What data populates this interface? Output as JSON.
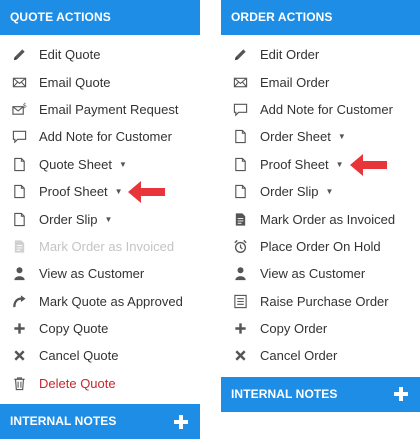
{
  "quote_panel": {
    "title": "QUOTE ACTIONS",
    "items": [
      {
        "label": "Edit Quote"
      },
      {
        "label": "Email Quote"
      },
      {
        "label": "Email Payment Request"
      },
      {
        "label": "Add Note for Customer"
      },
      {
        "label": "Quote Sheet",
        "caret": "▼"
      },
      {
        "label": "Proof Sheet",
        "caret": "▼"
      },
      {
        "label": "Order Slip",
        "caret": "▼"
      },
      {
        "label": "Mark Order as Invoiced"
      },
      {
        "label": "View as Customer"
      },
      {
        "label": "Mark Quote as Approved"
      },
      {
        "label": "Copy Quote"
      },
      {
        "label": "Cancel Quote"
      },
      {
        "label": "Delete Quote"
      }
    ],
    "internal_notes": "INTERNAL NOTES"
  },
  "order_panel": {
    "title": "ORDER ACTIONS",
    "items": [
      {
        "label": "Edit Order"
      },
      {
        "label": "Email Order"
      },
      {
        "label": "Add Note for Customer"
      },
      {
        "label": "Order Sheet",
        "caret": "▼"
      },
      {
        "label": "Proof Sheet",
        "caret": "▼"
      },
      {
        "label": "Order Slip",
        "caret": "▼"
      },
      {
        "label": "Mark Order as Invoiced"
      },
      {
        "label": "Place Order On Hold"
      },
      {
        "label": "View as Customer"
      },
      {
        "label": "Raise Purchase Order"
      },
      {
        "label": "Copy Order"
      },
      {
        "label": "Cancel Order"
      }
    ],
    "internal_notes": "INTERNAL NOTES"
  },
  "colors": {
    "header": "#1e8de6",
    "annotation_arrow": "#e8353a",
    "danger_text": "#c9262c",
    "disabled_text": "#c4c4c4"
  }
}
